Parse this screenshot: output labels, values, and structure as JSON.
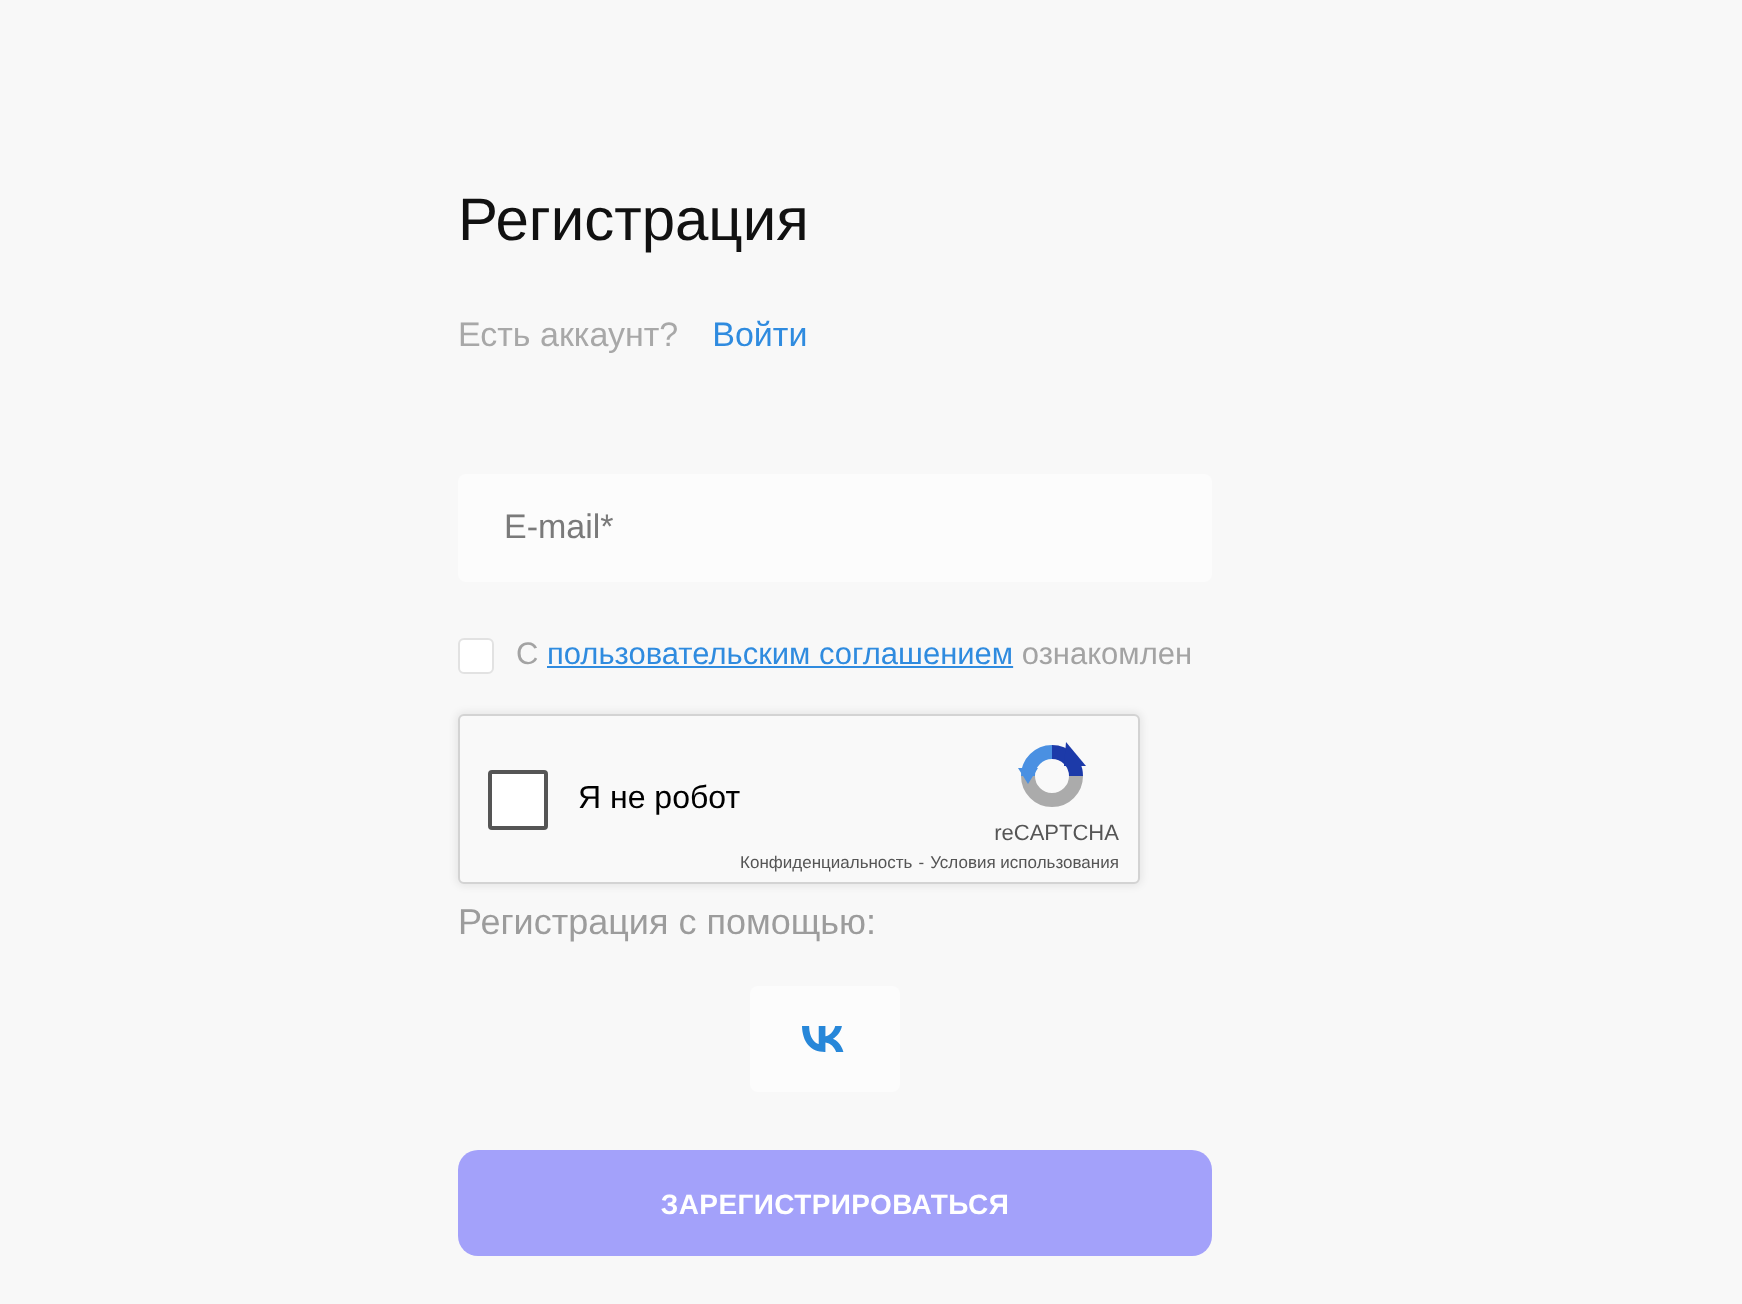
{
  "title": "Регистрация",
  "login_prompt": {
    "text": "Есть аккаунт?",
    "link": "Войти"
  },
  "email_field": {
    "placeholder": "E-mail*"
  },
  "agreement": {
    "checked": false,
    "text_before": "С",
    "link": "пользовательским соглашением",
    "text_after": "ознакомлен"
  },
  "captcha": {
    "checked": false,
    "label": "Я не робот",
    "brand": "reCAPTCHA",
    "privacy_link": "Конфиденциальность",
    "separator": "-",
    "terms_link": "Условия использования"
  },
  "social": {
    "label": "Регистрация с помощью:"
  },
  "submit_button": {
    "label": "ЗАРЕГИСТРИРОВАТЬСЯ"
  }
}
